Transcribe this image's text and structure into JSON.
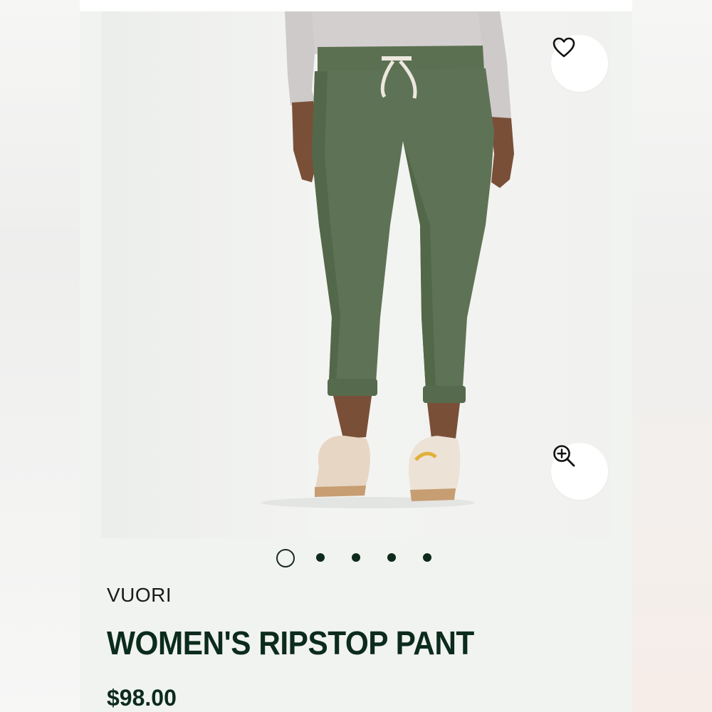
{
  "product": {
    "brand": "VUORI",
    "name": "WOMEN'S RIPSTOP PANT",
    "price": "$98.00",
    "pant_color": "#5e7355"
  },
  "actions": {
    "wishlist_icon": "heart-icon",
    "zoom_icon": "zoom-in-icon"
  },
  "carousel": {
    "total_images": 5,
    "active_index": 0
  },
  "colors": {
    "accent": "#0b2b1d",
    "card_background": "#f1f3f1"
  }
}
